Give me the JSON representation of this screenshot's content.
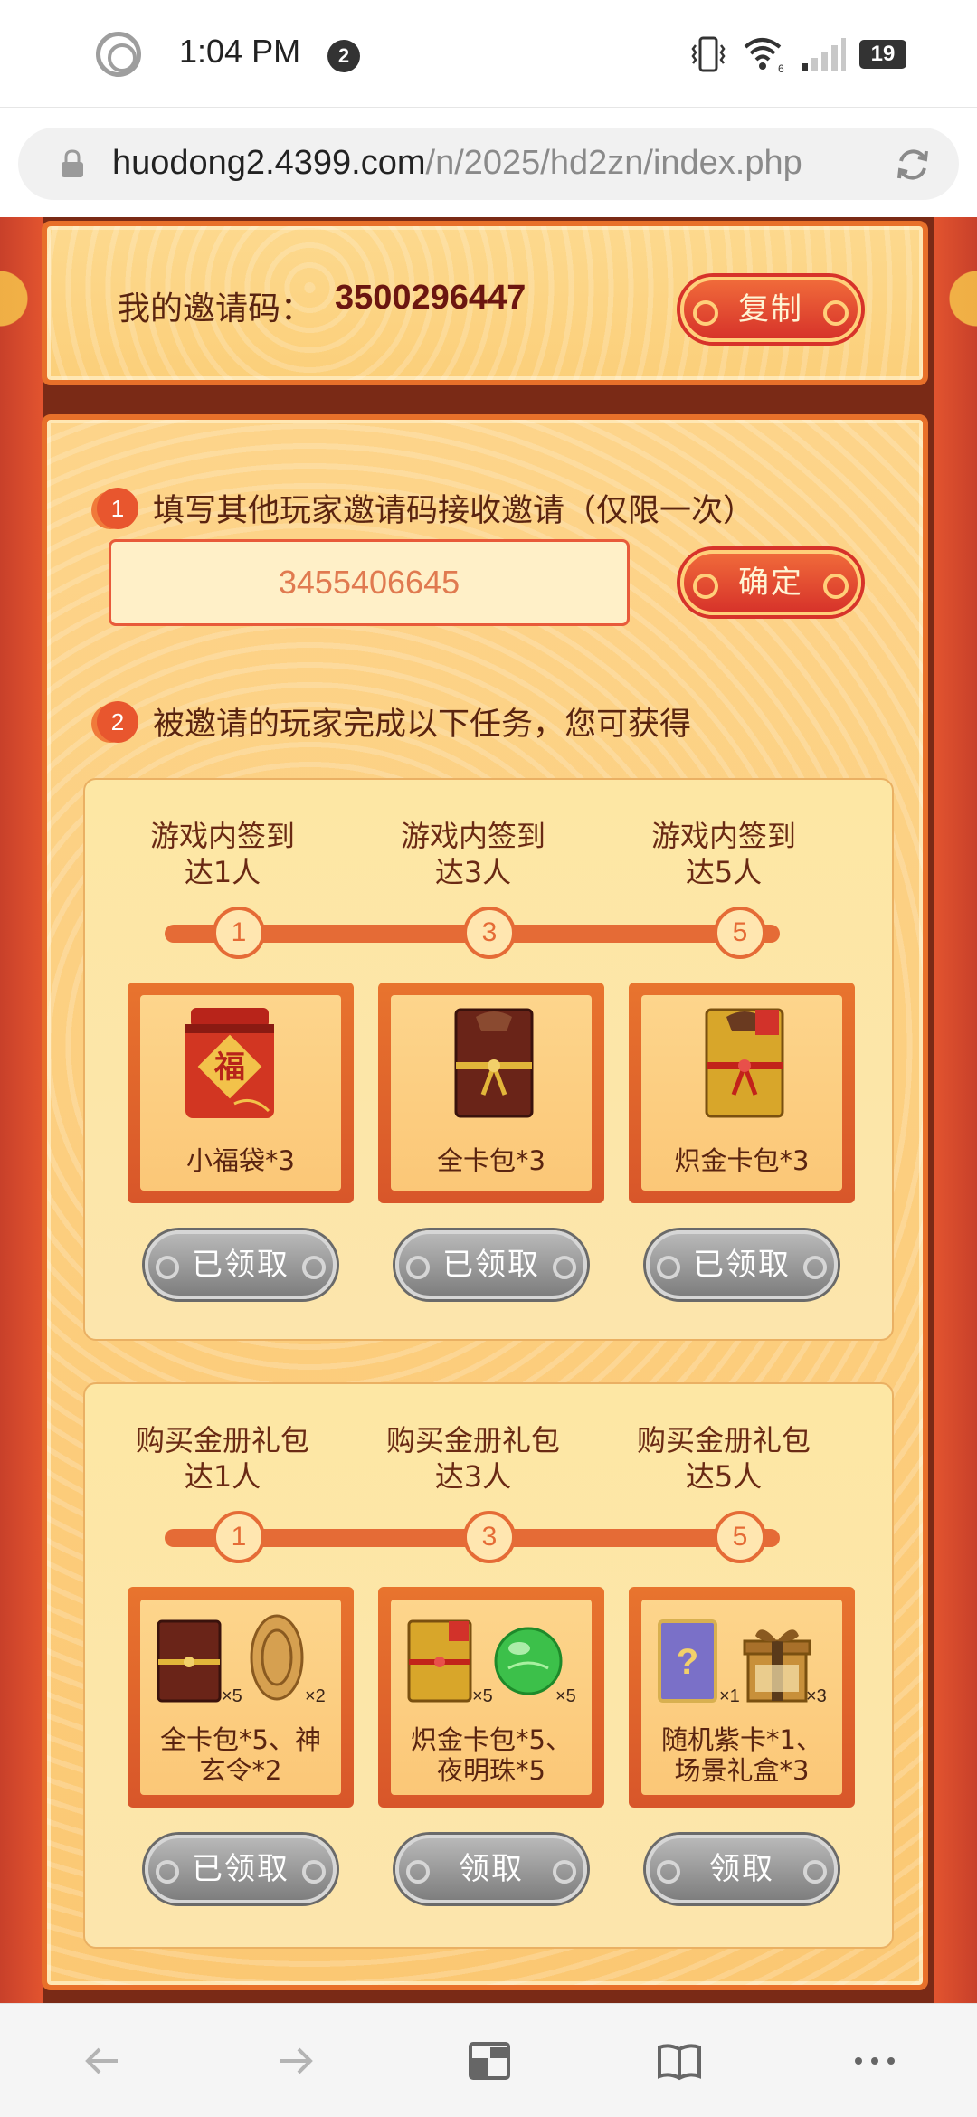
{
  "status_bar": {
    "time": "1:04 PM",
    "notification_count": "2",
    "wifi_label": "6",
    "battery": "19",
    "icons": [
      "record-icon",
      "vibrate-icon",
      "wifi-icon",
      "signal-icon",
      "battery-icon"
    ]
  },
  "browser": {
    "url_domain": "huodong2.4399.com",
    "url_path": "/n/2025/hd2zn/index.php",
    "nav": [
      "back-icon",
      "forward-icon",
      "tabs-icon",
      "bookmarks-icon",
      "more-icon"
    ]
  },
  "invite": {
    "label": "我的邀请码：",
    "code": "3500296447",
    "copy_label": "复制"
  },
  "step1": {
    "num": "1",
    "text": "填写其他玩家邀请码接收邀请（仅限一次）",
    "input_value": "3455406645",
    "confirm_label": "确定"
  },
  "step2": {
    "num": "2",
    "text": "被邀请的玩家完成以下任务，您可获得"
  },
  "tasks": [
    {
      "conditions": [
        {
          "line1": "游戏内签到",
          "line2": "达1人"
        },
        {
          "line1": "游戏内签到",
          "line2": "达3人"
        },
        {
          "line1": "游戏内签到",
          "line2": "达5人"
        }
      ],
      "milestones": [
        "1",
        "3",
        "5"
      ],
      "rewards": [
        {
          "name": "小福袋*3",
          "icon": "lucky-bag-icon"
        },
        {
          "name": "全卡包*3",
          "icon": "card-pack-icon"
        },
        {
          "name": "炽金卡包*3",
          "icon": "gold-card-pack-icon"
        }
      ],
      "buttons": [
        "已领取",
        "已领取",
        "已领取"
      ]
    },
    {
      "conditions": [
        {
          "line1": "购买金册礼包",
          "line2": "达1人"
        },
        {
          "line1": "购买金册礼包",
          "line2": "达3人"
        },
        {
          "line1": "购买金册礼包",
          "line2": "达5人"
        }
      ],
      "milestones": [
        "1",
        "3",
        "5"
      ],
      "rewards": [
        {
          "name_line1": "全卡包*5、神",
          "name_line2": "玄令*2",
          "qty_a": "×5",
          "qty_b": "×2"
        },
        {
          "name_line1": "炽金卡包*5、",
          "name_line2": "夜明珠*5",
          "qty_a": "×5",
          "qty_b": "×5"
        },
        {
          "name_line1": "随机紫卡*1、",
          "name_line2": "场景礼盒*3",
          "qty_a": "×1",
          "qty_b": "×3"
        }
      ],
      "buttons": [
        "已领取",
        "领取",
        "领取"
      ]
    }
  ],
  "colors": {
    "panel_border": "#e8702a",
    "panel_fill": "#fbd48a",
    "accent_red": "#d7332a",
    "text_brown": "#5a2410",
    "claimed_grey": "#8e8e8e"
  }
}
